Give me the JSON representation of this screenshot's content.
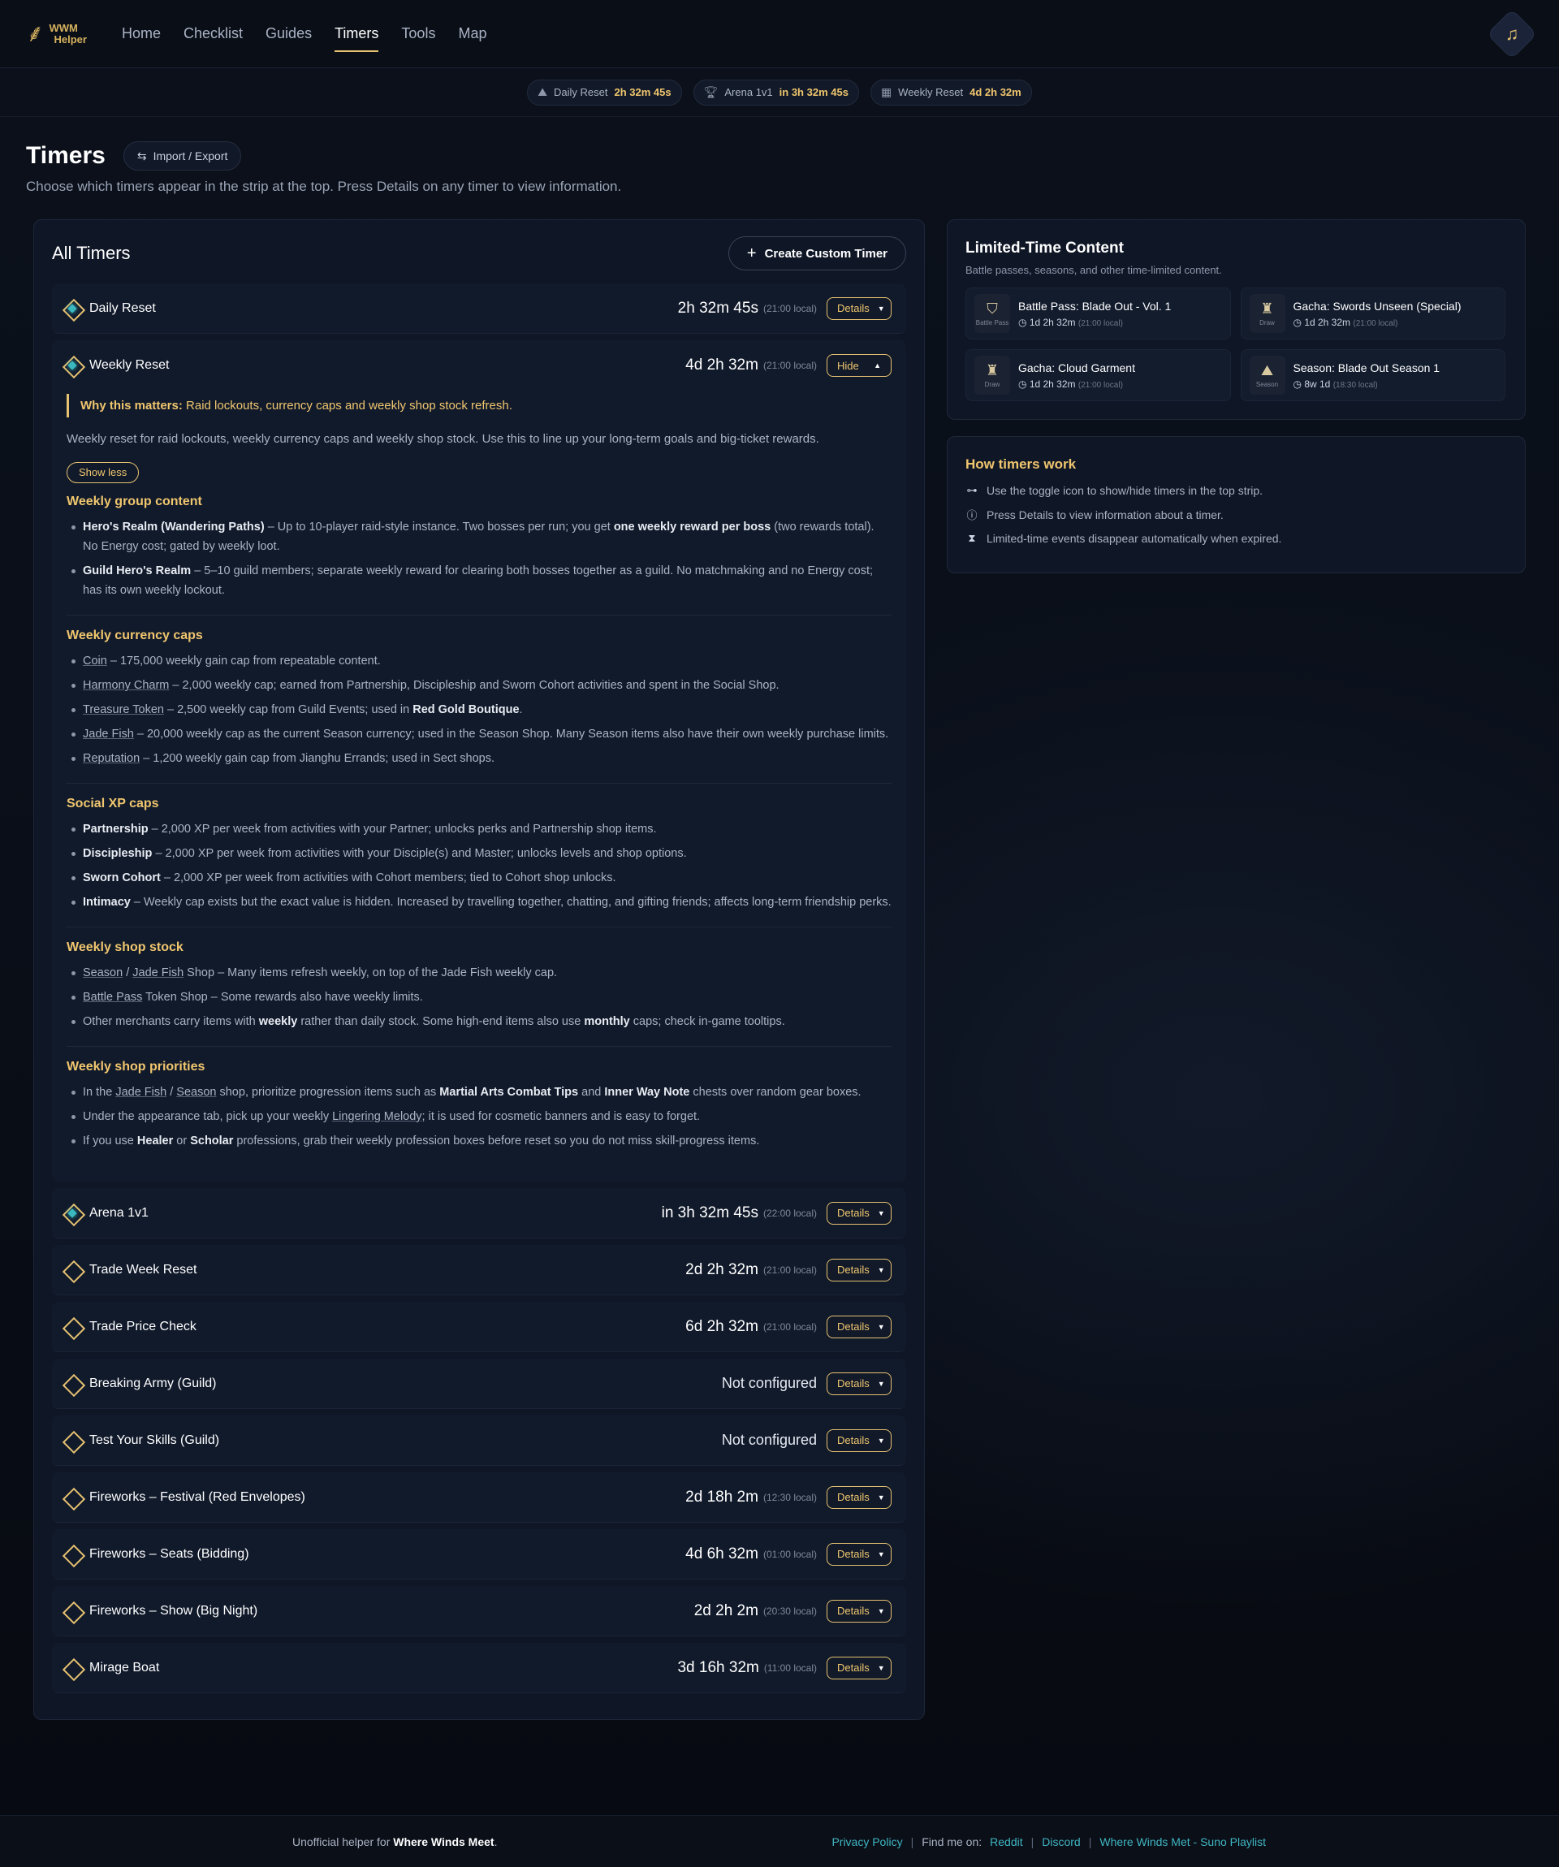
{
  "brand": {
    "line1": "WWM",
    "line2": "Helper"
  },
  "nav": [
    "Home",
    "Checklist",
    "Guides",
    "Timers",
    "Tools",
    "Map"
  ],
  "strip": [
    {
      "label": "Daily Reset",
      "value": "2h 32m 45s",
      "icon": "calendar-reset-icon"
    },
    {
      "label": "Arena 1v1",
      "value": "in 3h 32m 45s",
      "icon": "trophy-icon"
    },
    {
      "label": "Weekly Reset",
      "value": "4d 2h 32m",
      "icon": "calendar-week-icon"
    }
  ],
  "page": {
    "title": "Timers",
    "import_export": "Import / Export",
    "subtitle": "Choose which timers appear in the strip at the top. Press Details on any timer to view information."
  },
  "all_timers": {
    "heading": "All Timers",
    "create_button": "Create Custom Timer",
    "details_label": "Details",
    "hide_label": "Hide",
    "rows": [
      {
        "name": "Daily Reset",
        "time": "2h 32m 45s",
        "local": "(21:00 local)",
        "active": true
      },
      {
        "name": "Weekly Reset",
        "time": "4d 2h 32m",
        "local": "(21:00 local)",
        "active": true
      },
      {
        "name": "Arena 1v1",
        "time": "in 3h 32m 45s",
        "local": "(22:00 local)",
        "active": true
      },
      {
        "name": "Trade Week Reset",
        "time": "2d 2h 32m",
        "local": "(21:00 local)",
        "active": false
      },
      {
        "name": "Trade Price Check",
        "time": "6d 2h 32m",
        "local": "(21:00 local)",
        "active": false
      },
      {
        "name": "Breaking Army (Guild)",
        "time": "Not configured",
        "local": "",
        "active": false
      },
      {
        "name": "Test Your Skills (Guild)",
        "time": "Not configured",
        "local": "",
        "active": false
      },
      {
        "name": "Fireworks – Festival (Red Envelopes)",
        "time": "2d 18h 2m",
        "local": "(12:30 local)",
        "active": false
      },
      {
        "name": "Fireworks – Seats (Bidding)",
        "time": "4d 6h 32m",
        "local": "(01:00 local)",
        "active": false
      },
      {
        "name": "Fireworks – Show (Big Night)",
        "time": "2d 2h 2m",
        "local": "(20:30 local)",
        "active": false
      },
      {
        "name": "Mirage Boat",
        "time": "3d 16h 32m",
        "local": "(11:00 local)",
        "active": false
      }
    ]
  },
  "weekly_detail": {
    "why_label": "Why this matters:",
    "why_text": " Raid lockouts, currency caps and weekly shop stock refresh.",
    "description": "Weekly reset for raid lockouts, weekly currency caps and weekly shop stock. Use this to line up your long-term goals and big-ticket rewards.",
    "show_less": "Show less",
    "sections": [
      {
        "title": "Weekly group content",
        "items": [
          "<b>Hero's Realm (Wandering Paths)</b> – Up to 10-player raid-style instance. Two bosses per run; you get <b>one weekly reward per boss</b> (two rewards total). No Energy cost; gated by weekly loot.",
          "<b>Guild Hero's Realm</b> – 5–10 guild members; separate weekly reward for clearing both bosses together as a guild. No matchmaking and no Energy cost; has its own weekly lockout."
        ]
      },
      {
        "title": "Weekly currency caps",
        "items": [
          "<u>Coin</u> – 175,000 weekly gain cap from repeatable content.",
          "<u>Harmony Charm</u> – 2,000 weekly cap; earned from Partnership, Discipleship and Sworn Cohort activities and spent in the Social Shop.",
          "<u>Treasure Token</u> – 2,500 weekly cap from Guild Events; used in <b>Red Gold Boutique</b>.",
          "<u>Jade Fish</u> – 20,000 weekly cap as the current Season currency; used in the Season Shop. Many Season items also have their own weekly purchase limits.",
          "<u>Reputation</u> – 1,200 weekly gain cap from Jianghu Errands; used in Sect shops."
        ]
      },
      {
        "title": "Social XP caps",
        "items": [
          "<b>Partnership</b> – 2,000 XP per week from activities with your Partner; unlocks perks and Partnership shop items.",
          "<b>Discipleship</b> – 2,000 XP per week from activities with your Disciple(s) and Master; unlocks levels and shop options.",
          "<b>Sworn Cohort</b> – 2,000 XP per week from activities with Cohort members; tied to Cohort shop unlocks.",
          "<b>Intimacy</b> – Weekly cap exists but the exact value is hidden. Increased by travelling together, chatting, and gifting friends; affects long-term friendship perks."
        ]
      },
      {
        "title": "Weekly shop stock",
        "items": [
          "<u>Season</u> / <u>Jade Fish</u> Shop – Many items refresh weekly, on top of the Jade Fish weekly cap.",
          "<u>Battle Pass</u> Token Shop – Some rewards also have weekly limits.",
          "Other merchants carry items with <b>weekly</b> rather than daily stock. Some high-end items also use <b>monthly</b> caps; check in-game tooltips."
        ]
      },
      {
        "title": "Weekly shop priorities",
        "items": [
          "In the <u>Jade Fish</u> / <u>Season</u> shop, prioritize progression items such as <b>Martial Arts Combat Tips</b> and <b>Inner Way Note</b> chests over random gear boxes.",
          "Under the appearance tab, pick up your weekly <u>Lingering Melody</u>; it is used for cosmetic banners and is easy to forget.",
          "If you use <b>Healer</b> or <b>Scholar</b> professions, grab their weekly profession boxes before reset so you do not miss skill-progress items."
        ]
      }
    ]
  },
  "limited": {
    "title": "Limited-Time Content",
    "subtitle": "Battle passes, seasons, and other time-limited content.",
    "items": [
      {
        "name": "Battle Pass: Blade Out - Vol. 1",
        "time": "1d 2h 32m",
        "local": "(21:00 local)",
        "tag": "Battle Pass",
        "icon": "battle-pass-icon"
      },
      {
        "name": "Gacha: Swords Unseen (Special)",
        "time": "1d 2h 32m",
        "local": "(21:00 local)",
        "tag": "Draw",
        "icon": "draw-icon"
      },
      {
        "name": "Gacha: Cloud Garment",
        "time": "1d 2h 32m",
        "local": "(21:00 local)",
        "tag": "Draw",
        "icon": "draw-icon"
      },
      {
        "name": "Season: Blade Out Season 1",
        "time": "8w 1d",
        "local": "(18:30 local)",
        "tag": "Season",
        "icon": "season-icon"
      }
    ]
  },
  "how": {
    "title": "How timers work",
    "items": [
      {
        "text": "Use the toggle icon to show/hide timers in the top strip.",
        "icon": "toggle-icon"
      },
      {
        "text": "Press Details to view information about a timer.",
        "icon": "info-icon"
      },
      {
        "text": "Limited-time events disappear automatically when expired.",
        "icon": "hourglass-icon"
      }
    ]
  },
  "footer": {
    "left_prefix": "Unofficial helper for ",
    "left_bold": "Where Winds Meet",
    "left_suffix": ".",
    "privacy": "Privacy Policy",
    "find_me": "Find me on:",
    "reddit": "Reddit",
    "discord": "Discord",
    "playlist": "Where Winds Met - Suno Playlist"
  },
  "colors": {
    "accent": "#e6c170",
    "teal": "#3ab8c0",
    "link": "#3fb6c2",
    "bg": "#0b101b"
  }
}
